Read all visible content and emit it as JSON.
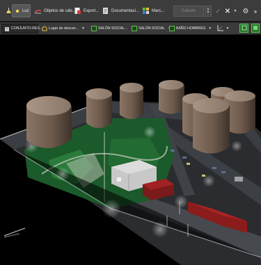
{
  "toolbar": {
    "light_label": "Luz",
    "calc_objects_label": "Objetos de cálc...",
    "export_label": "Export...",
    "documentation_label": "Documentaci...",
    "marc_label": "Marc...",
    "calc_input_placeholder": "Cálculo"
  },
  "breadcrumb": {
    "items": [
      {
        "label": "CONJUNTO RES..."
      },
      {
        "label": "Lugar de descan..."
      },
      {
        "label": "SALÓN SOCIAL..."
      },
      {
        "label": "SALÓN SOCIAL"
      },
      {
        "label": "BAÑO HOMBRES"
      }
    ]
  },
  "colors": {
    "toolbar_bg": "#3c3c3c",
    "accent_green": "#58c158",
    "grass": "#1b5a2a",
    "road": "#3a3d42",
    "tower": "#6e5a4c",
    "roof_red": "#a12222"
  }
}
